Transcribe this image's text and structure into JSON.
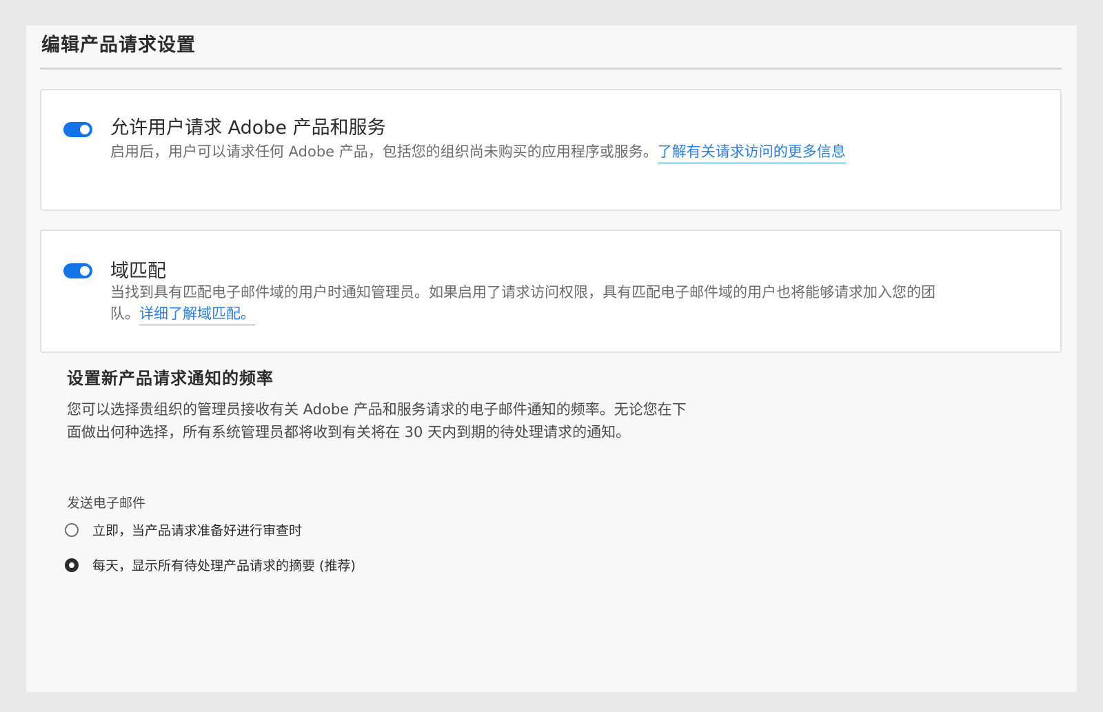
{
  "page": {
    "title": "编辑产品请求设置"
  },
  "cards": [
    {
      "toggle_on": true,
      "heading": "允许用户请求 Adobe 产品和服务",
      "description": "启用后，用户可以请求任何 Adobe 产品，包括您的组织尚未购买的应用程序或服务。",
      "link": "了解有关请求访问的更多信息"
    },
    {
      "toggle_on": true,
      "heading": "域匹配",
      "description": "当找到具有匹配电子邮件域的用户时通知管理员。如果启用了请求访问权限，具有匹配电子邮件域的用户也将能够请求加入您的团队。",
      "link": "详细了解域匹配。"
    }
  ],
  "frequency": {
    "heading": "设置新产品请求通知的频率",
    "description": "您可以选择贵组织的管理员接收有关 Adobe 产品和服务请求的电子邮件通知的频率。无论您在下面做出何种选择，所有系统管理员都将收到有关将在 30 天内到期的待处理请求的通知。",
    "email_label": "发送电子邮件",
    "options": [
      {
        "label": "立即，当产品请求准备好进行审查时",
        "selected": false
      },
      {
        "label": "每天，显示所有待处理产品请求的摘要 (推荐)",
        "selected": true
      }
    ]
  },
  "colors": {
    "accent": "#1473e6",
    "link": "#2d7fe0"
  }
}
